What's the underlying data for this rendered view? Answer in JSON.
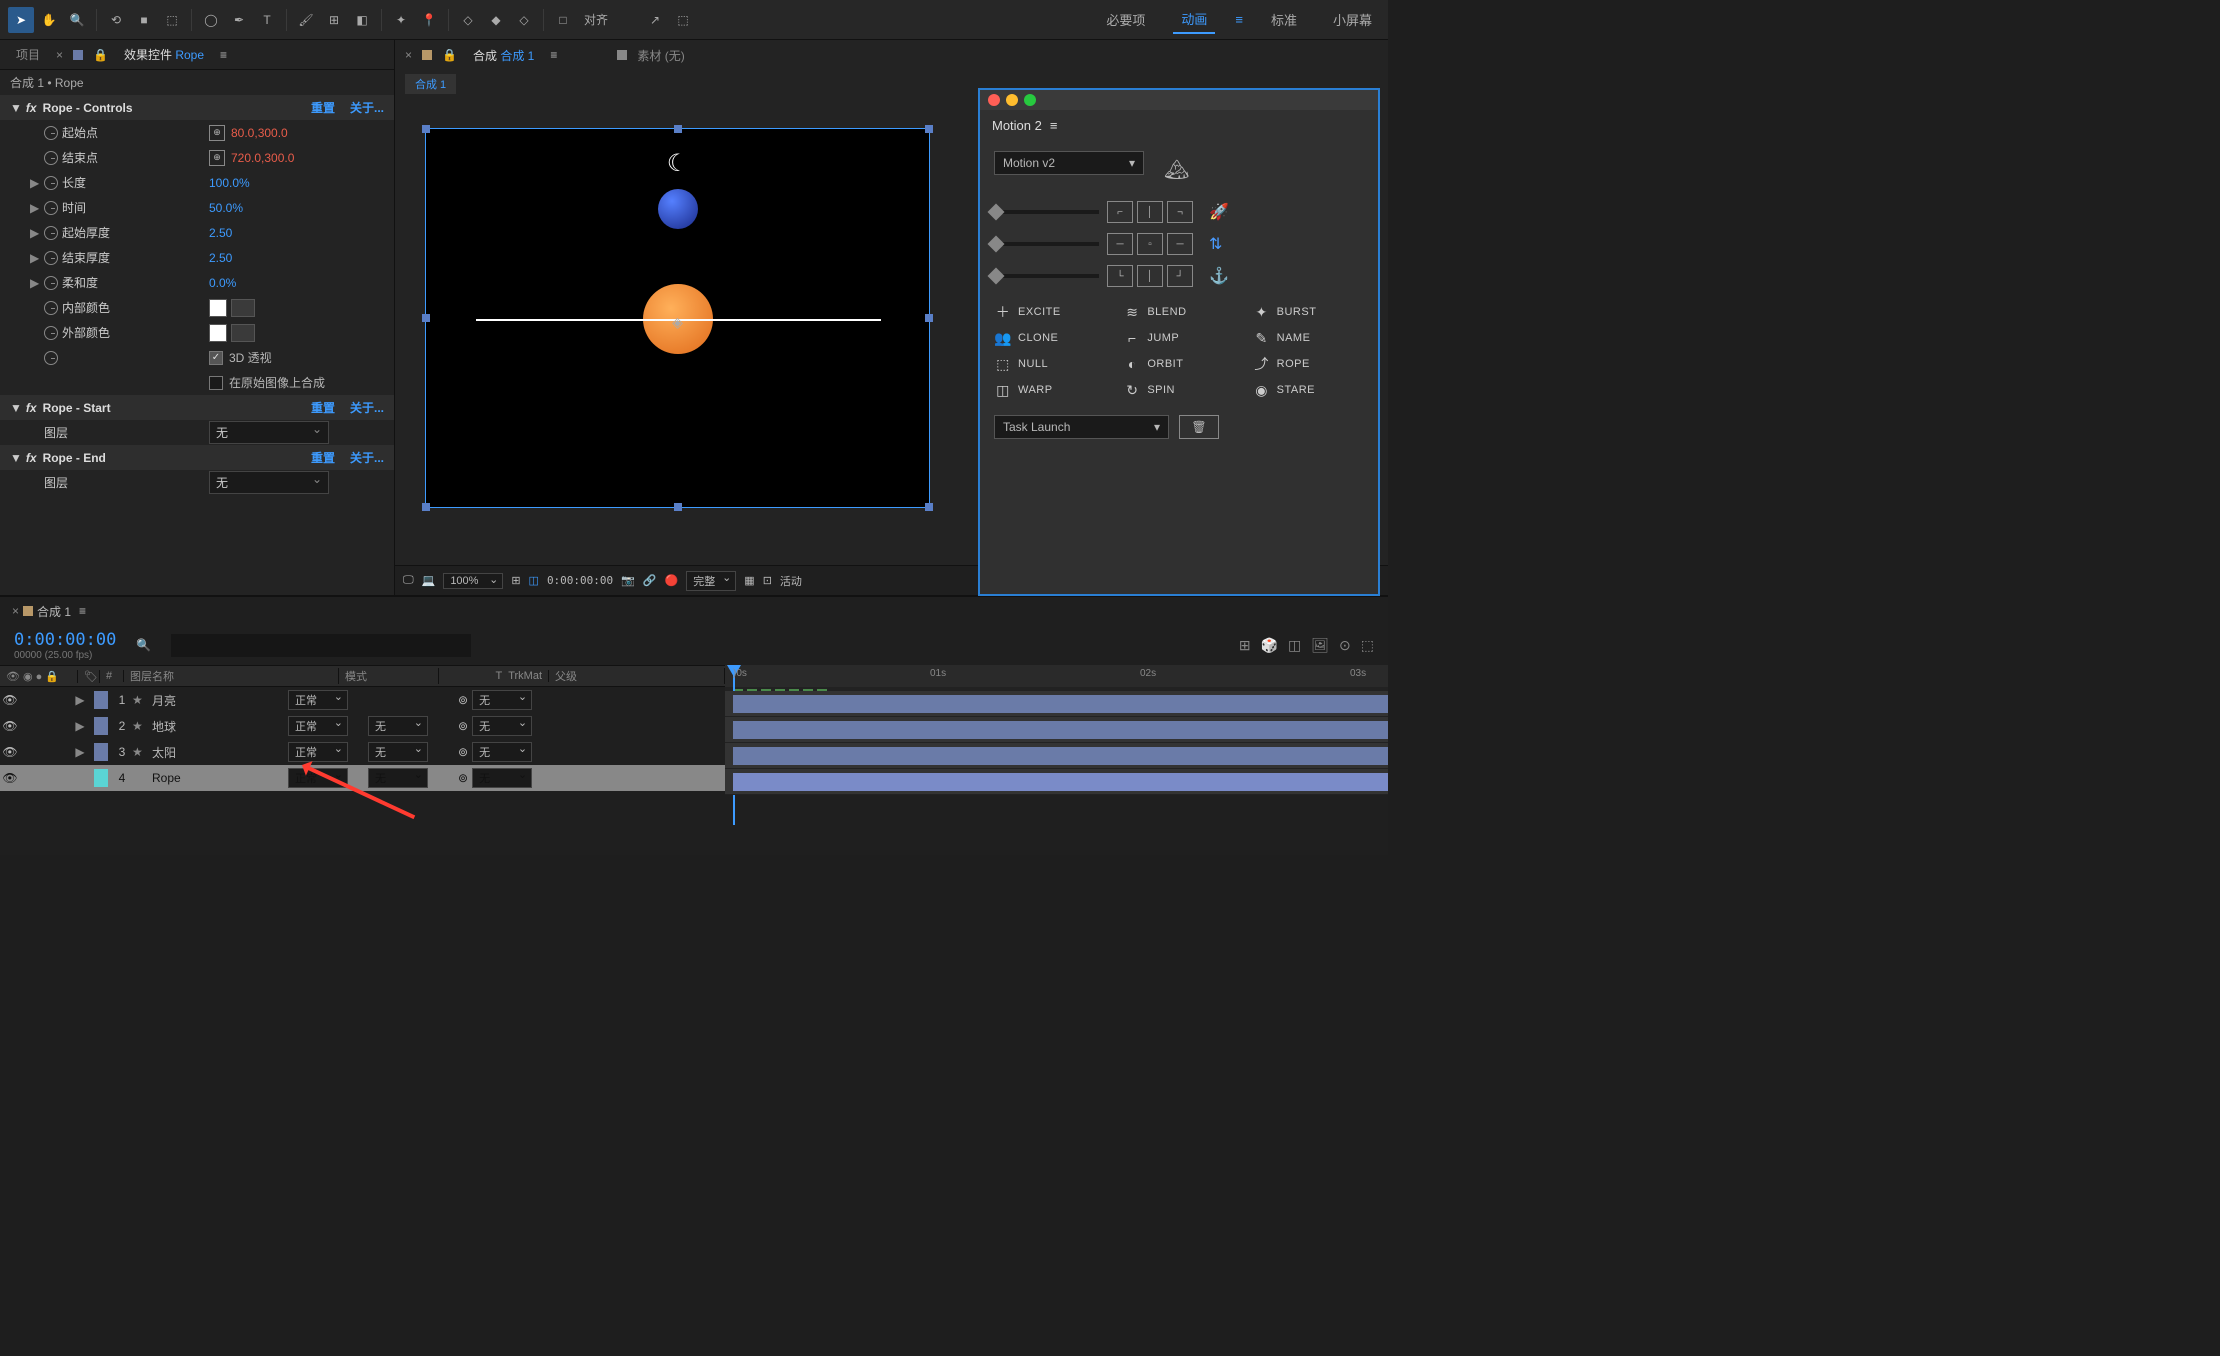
{
  "toolbar": {
    "align_label": "对齐"
  },
  "workspace": {
    "tabs": [
      "必要项",
      "动画",
      "标准",
      "小屏幕"
    ],
    "active": "动画"
  },
  "panels": {
    "project": "项目",
    "effect_controls": "效果控件",
    "effect_target": "Rope",
    "breadcrumb": "合成 1 • Rope"
  },
  "fx": {
    "controls": {
      "title": "Rope - Controls",
      "reset": "重置",
      "about": "关于...",
      "props": {
        "start_point": {
          "label": "起始点",
          "value": "80.0,300.0"
        },
        "end_point": {
          "label": "结束点",
          "value": "720.0,300.0"
        },
        "length": {
          "label": "长度",
          "value": "100.0%"
        },
        "time": {
          "label": "时间",
          "value": "50.0%"
        },
        "start_thickness": {
          "label": "起始厚度",
          "value": "2.50"
        },
        "end_thickness": {
          "label": "结束厚度",
          "value": "2.50"
        },
        "softness": {
          "label": "柔和度",
          "value": "0.0%"
        },
        "inner_color": {
          "label": "内部颜色"
        },
        "outer_color": {
          "label": "外部颜色"
        },
        "perspective_3d": {
          "label": "3D 透视",
          "checked": true
        },
        "composite_original": {
          "label": "在原始图像上合成",
          "checked": false
        }
      }
    },
    "start": {
      "title": "Rope - Start",
      "reset": "重置",
      "about": "关于...",
      "layer_label": "图层",
      "layer_value": "无"
    },
    "end": {
      "title": "Rope - End",
      "reset": "重置",
      "about": "关于...",
      "layer_label": "图层",
      "layer_value": "无"
    }
  },
  "comp": {
    "tab_prefix": "合成",
    "tab_name": "合成 1",
    "source_label": "素材",
    "source_value": "(无)",
    "subtab": "合成 1"
  },
  "viewer_footer": {
    "zoom": "100%",
    "timecode": "0:00:00:00",
    "quality": "完整",
    "view": "活动"
  },
  "motion2": {
    "title": "Motion 2",
    "version": "Motion v2",
    "actions": [
      {
        "icon": "＋",
        "label": "EXCITE"
      },
      {
        "icon": "≋",
        "label": "BLEND"
      },
      {
        "icon": "✦",
        "label": "BURST"
      },
      {
        "icon": "👥",
        "label": "CLONE"
      },
      {
        "icon": "⌐",
        "label": "JUMP"
      },
      {
        "icon": "✎",
        "label": "NAME"
      },
      {
        "icon": "⬚",
        "label": "NULL"
      },
      {
        "icon": "◐",
        "label": "ORBIT"
      },
      {
        "icon": "⤴",
        "label": "ROPE"
      },
      {
        "icon": "◫",
        "label": "WARP"
      },
      {
        "icon": "↻",
        "label": "SPIN"
      },
      {
        "icon": "◉",
        "label": "STARE"
      }
    ],
    "task_launch": "Task Launch"
  },
  "timeline": {
    "tab": "合成 1",
    "timecode": "0:00:00:00",
    "fps": "00000 (25.00 fps)",
    "columns": {
      "num": "#",
      "layer_name": "图层名称",
      "mode": "模式",
      "trkmat": "TrkMat",
      "parent": "父级"
    },
    "mode_normal": "正常",
    "none": "无",
    "layers": [
      {
        "num": 1,
        "name": "月亮",
        "color": "#6a7ba8"
      },
      {
        "num": 2,
        "name": "地球",
        "color": "#6a7ba8"
      },
      {
        "num": 3,
        "name": "太阳",
        "color": "#6a7ba8"
      },
      {
        "num": 4,
        "name": "Rope",
        "color": "#5ad4d4",
        "selected": true
      }
    ],
    "ruler": {
      "marks": [
        ")0s",
        "01s",
        "02s",
        "03s"
      ]
    }
  }
}
